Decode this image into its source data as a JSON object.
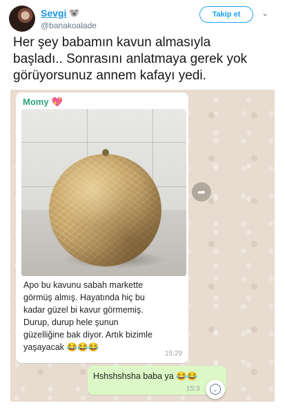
{
  "tweet": {
    "display_name": "Sevgi",
    "name_emoji": "🐨",
    "handle": "@banakoalade",
    "follow_label": "Takip et",
    "caret_icon": "chevron-down-icon",
    "text_lines": [
      "Her şey babamın kavun almasıyla",
      "başladı.. Sonrasını anlatmaya gerek yok",
      "görüyorsunuz annem kafayı yedi."
    ]
  },
  "chat": {
    "incoming": {
      "sender": "Momy",
      "sender_emoji": "💖",
      "message_lines": [
        "Apo bu kavunu sabah markette",
        "görmüş almış. Hayatında hiç bu",
        "kadar güzel bi kavur görmemiş.",
        "Durup, durup hele şunun",
        "güzelliğine bak diyor. Artık bizimle",
        "yaşayacak 😂😂😂"
      ],
      "time": "15:29"
    },
    "outgoing": {
      "text": "Hshshshsha baba ya 😂😂",
      "time": "15:3"
    }
  },
  "colors": {
    "link_blue": "#1b95e0",
    "follow_blue": "#1da1f2",
    "sender_green": "#2fa37c",
    "outgoing_bubble": "#dcf8c6",
    "chat_background": "#e7dccf"
  }
}
